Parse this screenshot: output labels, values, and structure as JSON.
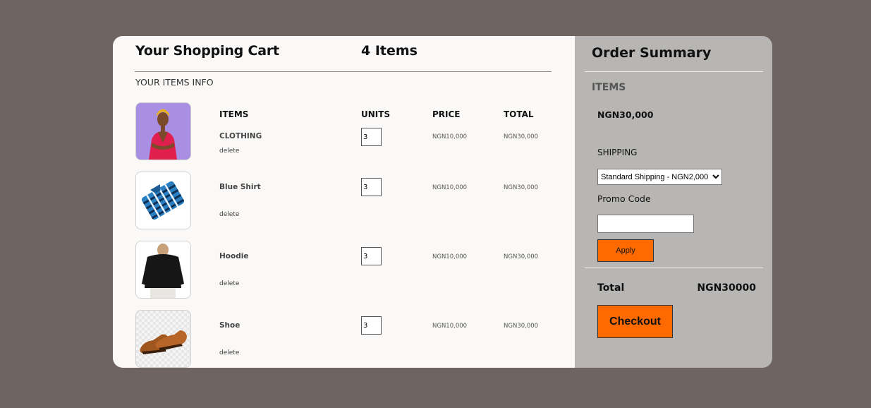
{
  "cart": {
    "title": "Your Shopping Cart",
    "item_count": "4 Items",
    "section_label": "YOUR ITEMS INFO",
    "columns": {
      "items": "ITEMS",
      "units": "UNITS",
      "price": "PRICE",
      "total": "TOTAL"
    },
    "items": [
      {
        "name": "CLOTHING",
        "delete_label": "delete",
        "quantity": "3",
        "price": "NGN10,000",
        "total": "NGN30,000",
        "image": "woman-in-red-top-photo"
      },
      {
        "name": "Blue Shirt",
        "delete_label": "delete",
        "quantity": "3",
        "price": "NGN10,000",
        "total": "NGN30,000",
        "image": "folded-plaid-shirt-photo"
      },
      {
        "name": "Hoodie",
        "delete_label": "delete",
        "quantity": "3",
        "price": "NGN10,000",
        "total": "NGN30,000",
        "image": "black-hoodie-photo"
      },
      {
        "name": "Shoe",
        "delete_label": "delete",
        "quantity": "3",
        "price": "NGN10,000",
        "total": "NGN30,000",
        "image": "brown-leather-shoes-photo"
      }
    ]
  },
  "summary": {
    "title": "Order Summary",
    "items_label": "ITEMS",
    "items_value": "NGN30,000",
    "shipping_label": "SHIPPING",
    "shipping_selected": "Standard Shipping - NGN2,000",
    "promo_label": "Promo Code",
    "promo_value": "",
    "apply_label": "Apply",
    "total_label": "Total",
    "total_value": "NGN30000",
    "checkout_label": "Checkout"
  },
  "colors": {
    "page_background": "#6e6462",
    "cart_panel": "#faf9f7",
    "summary_panel": "#b7b6b4",
    "accent_button": "#ff6a00"
  }
}
